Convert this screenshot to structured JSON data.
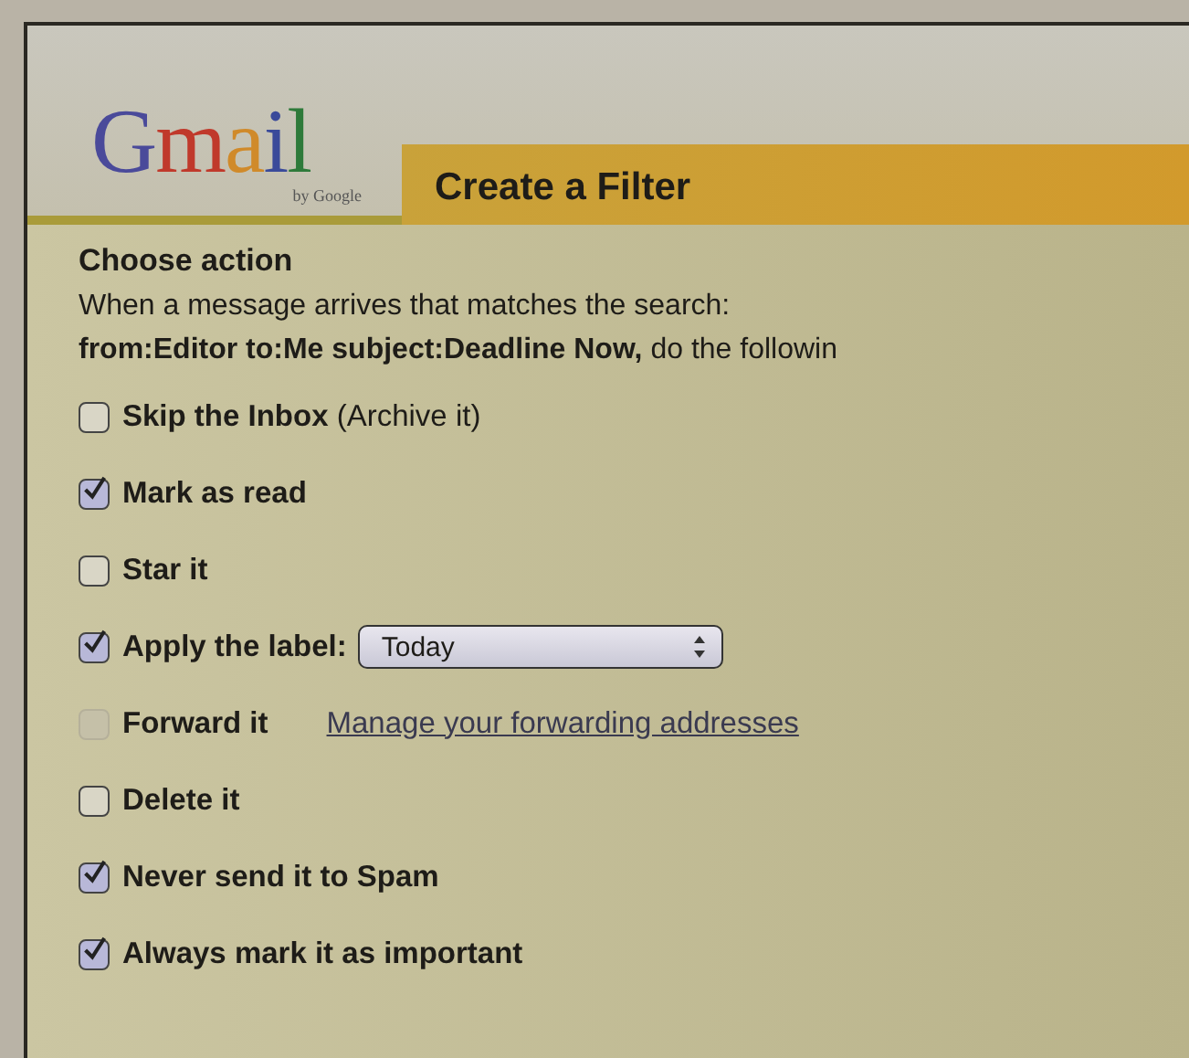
{
  "logo": {
    "wordmark": "Gmail",
    "tagline": "by Google"
  },
  "tab": {
    "title": "Create a Filter"
  },
  "section": {
    "heading": "Choose action",
    "intro": "When a message arrives that matches the search:",
    "criteria": "**from:Editor to:Me subject:Deadline Now,** do the followin"
  },
  "actions": [
    {
      "kind": "checkbox",
      "label": "**Skip the Inbox** (Archive it)",
      "checked": false,
      "disabled": false
    },
    {
      "kind": "checkbox",
      "label": "**Mark as read**",
      "checked": true,
      "disabled": false
    },
    {
      "kind": "checkbox",
      "label": "**Star it**",
      "checked": false,
      "disabled": false
    },
    {
      "kind": "select",
      "label": "**Apply the label:**",
      "checked": true,
      "disabled": false,
      "value": "Today"
    },
    {
      "kind": "link",
      "label": "**Forward it**",
      "checked": false,
      "disabled": true,
      "link": "Manage your forwarding addresses"
    },
    {
      "kind": "checkbox",
      "label": "**Delete it**",
      "checked": false,
      "disabled": false
    },
    {
      "kind": "checkbox",
      "label": "**Never send it to Spam**",
      "checked": true,
      "disabled": false
    },
    {
      "kind": "checkbox",
      "label": "**Always mark it as important**",
      "checked": true,
      "disabled": false
    }
  ]
}
